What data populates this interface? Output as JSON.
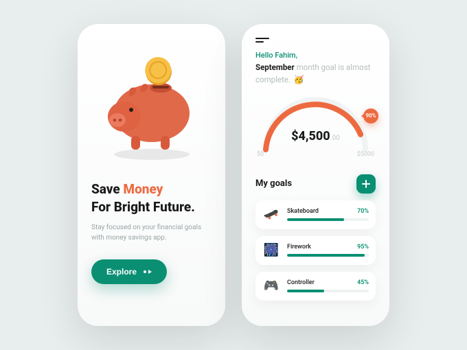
{
  "onboarding": {
    "headline_pre": "Save ",
    "headline_accent": "Money",
    "headline_post": "For Bright Future.",
    "subcopy": "Stay focused on your financial goals with money savings app.",
    "cta_label": "Explore"
  },
  "dashboard": {
    "greeting": "Hello Fahim,",
    "status_month": "September",
    "status_rest": " month goal is almost complete.",
    "status_emoji": "🥳",
    "gauge": {
      "percent_label": "90%",
      "amount_main": "$4,500",
      "amount_cents": ".00",
      "range_min": "$0",
      "range_max": "$5000"
    },
    "goals_title": "My goals",
    "goals": [
      {
        "name": "Skateboard",
        "pct_label": "70%",
        "pct": 70,
        "emoji": "🛹"
      },
      {
        "name": "Firework",
        "pct_label": "95%",
        "pct": 95,
        "emoji": "🎆"
      },
      {
        "name": "Controller",
        "pct_label": "45%",
        "pct": 45,
        "emoji": "🎮"
      }
    ]
  },
  "colors": {
    "accent": "#ed6a40",
    "brand": "#0a8f73"
  }
}
